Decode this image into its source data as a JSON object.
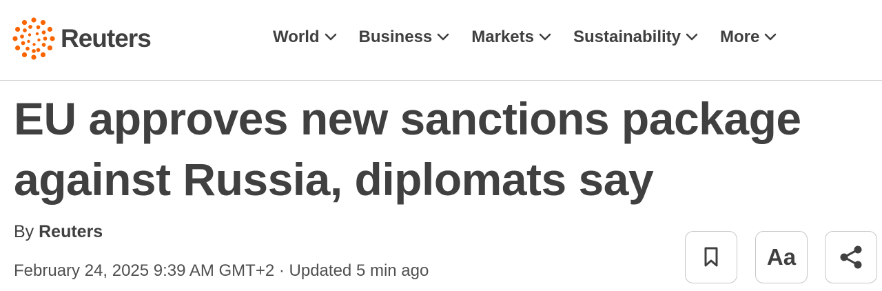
{
  "brand": {
    "name": "Reuters",
    "accent": "#fa6400"
  },
  "nav": {
    "items": [
      {
        "label": "World"
      },
      {
        "label": "Business"
      },
      {
        "label": "Markets"
      },
      {
        "label": "Sustainability"
      },
      {
        "label": "More"
      }
    ]
  },
  "article": {
    "headline": "EU approves new sanctions package against Russia, diplomats say",
    "byline_prefix": "By ",
    "author": "Reuters",
    "date": "February 24, 2025 9:39 AM GMT+2",
    "separator": " · ",
    "updated": "Updated 5 min ago"
  },
  "tools": {
    "bookmark_icon": "bookmark-icon",
    "font_label": "Aa",
    "share_icon": "share-icon"
  }
}
